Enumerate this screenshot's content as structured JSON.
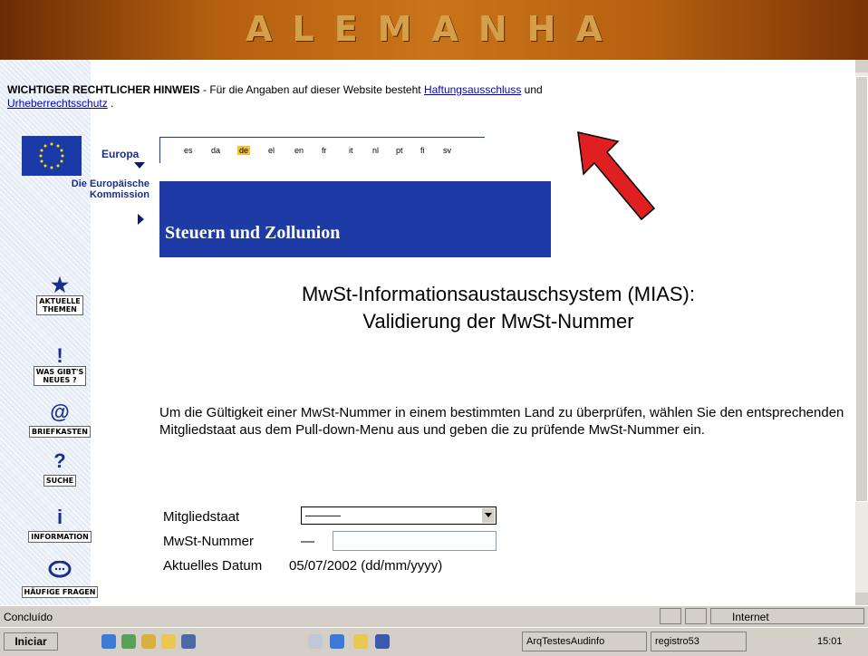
{
  "banner": {
    "title": "ALEMANHA"
  },
  "legal": {
    "bold": "WICHTIGER RECHTLICHER HINWEIS",
    "text": " - Für die Angaben auf dieser Website besteht ",
    "link1": "Haftungsausschluss",
    "and": " und ",
    "link2": "Urheberrechtsschutz",
    "end": " ."
  },
  "eu": {
    "europa": "Europa",
    "kommission_1": "Die Europäische",
    "kommission_2": "Kommission"
  },
  "languages": [
    "es",
    "da",
    "de",
    "el",
    "en",
    "fr",
    "it",
    "nl",
    "pt",
    "fi",
    "sv"
  ],
  "selected_language": "de",
  "section_title": "Steuern und Zollunion",
  "heading": {
    "line1": "MwSt-Informationsaustauschsystem (MIAS):",
    "line2": "Validierung der MwSt-Nummer"
  },
  "intro": "Um die Gültigkeit einer MwSt-Nummer in einem bestimmten Land zu überprüfen, wählen Sie den entsprechenden Mitgliedstaat aus dem Pull-down-Menu aus und geben die zu prüfende MwSt-Nummer ein.",
  "form": {
    "member_state_label": "Mitgliedstaat",
    "member_state_value": "———",
    "vat_label": "MwSt-Nummer",
    "vat_prefix": "—",
    "vat_value": "",
    "date_label": "Aktuelles Datum",
    "date_value": "05/07/2002 (dd/mm/yyyy)"
  },
  "sidebar": [
    {
      "icon": "star-icon",
      "symbol": "★",
      "label_1": "AKTUELLE",
      "label_2": "THEMEN"
    },
    {
      "icon": "exclamation-icon",
      "symbol": "!",
      "label_1": "WAS GIBT'S",
      "label_2": "NEUES ?"
    },
    {
      "icon": "at-icon",
      "symbol": "@",
      "label_1": "BRIEFKASTEN",
      "label_2": ""
    },
    {
      "icon": "question-icon",
      "symbol": "?",
      "label_1": "SUCHE",
      "label_2": ""
    },
    {
      "icon": "info-icon",
      "symbol": "i",
      "label_1": "INFORMATION",
      "label_2": ""
    },
    {
      "icon": "speech-bubble-icon",
      "symbol": "💬",
      "label_1": "HÄUFIGE FRAGEN",
      "label_2": ""
    }
  ],
  "status": {
    "left": "Concluído",
    "zone": "Internet"
  },
  "taskbar": {
    "start": "Iniciar",
    "task1": "ArqTestesAudinfo",
    "task2": "registro53",
    "clock": "15:01"
  },
  "colors": {
    "accent_blue": "#1e3aa4",
    "arrow_red": "#e02020",
    "banner_orange": "#c9741a"
  }
}
